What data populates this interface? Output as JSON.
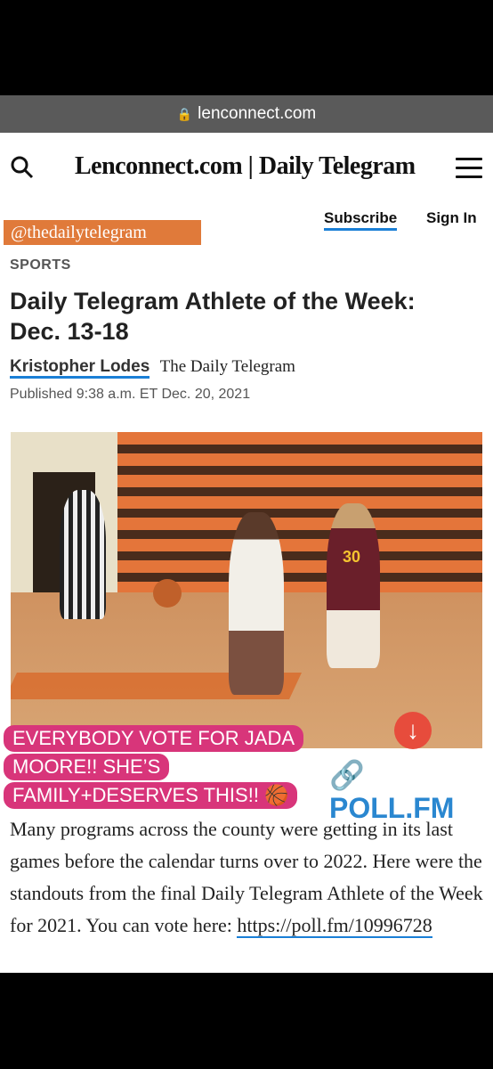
{
  "browser": {
    "url": "lenconnect.com"
  },
  "header": {
    "brand": "Lenconnect.com | Daily Telegram",
    "subscribe": "Subscribe",
    "signin": "Sign In"
  },
  "sticker": {
    "handle": "@thedailytelegram"
  },
  "article": {
    "section": "SPORTS",
    "headline": "Daily Telegram Athlete of the Week: Dec. 13-18",
    "author": "Kristopher Lodes",
    "publication": "The Daily Telegram",
    "published": "Published 9:38 a.m. ET Dec. 20, 2021",
    "photo_jersey": "30",
    "body": "Many programs across the county were getting in its last games before the calendar turns over to 2022. Here were the standouts from the final Daily Telegram Athlete of the Week for 2021. You can vote here: ",
    "link": "https://poll.fm/10996728"
  },
  "captions": {
    "line1": "EVERYBODY VOTE FOR JADA",
    "line2": "MOORE!! SHE’S",
    "line3": "FAMILY+DESERVES THIS!! 🏀",
    "poll": "POLL.FM"
  }
}
